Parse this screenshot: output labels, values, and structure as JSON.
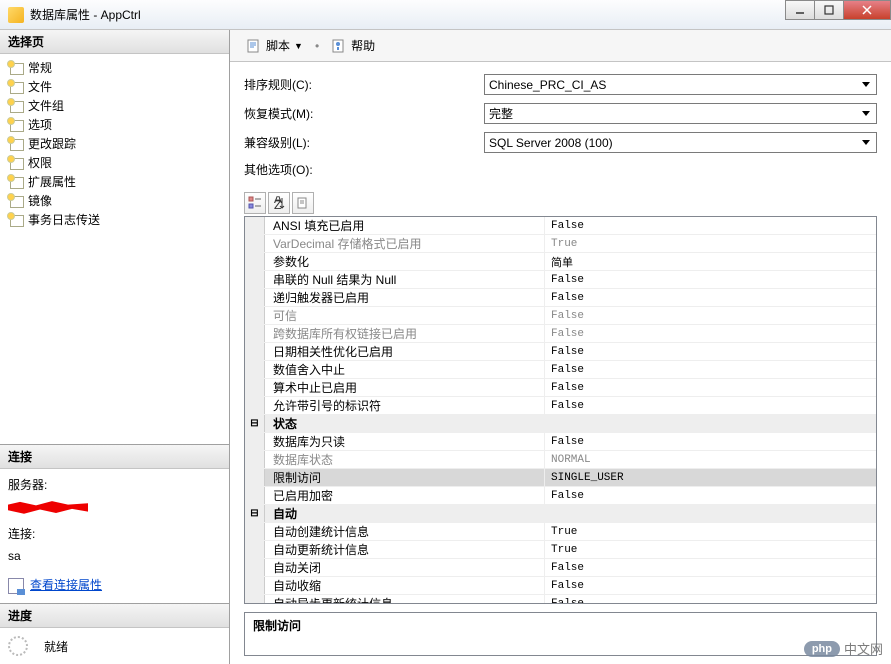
{
  "window": {
    "title": "数据库属性 - AppCtrl"
  },
  "leftPanel": {
    "selectPageHeader": "选择页",
    "navItems": [
      "常规",
      "文件",
      "文件组",
      "选项",
      "更改跟踪",
      "权限",
      "扩展属性",
      "镜像",
      "事务日志传送"
    ],
    "connectionHeader": "连接",
    "serverLabel": "服务器:",
    "connLabel": "连接:",
    "connValue": "sa",
    "viewConnPropsLink": "查看连接属性",
    "progressHeader": "进度",
    "progressStatus": "就绪"
  },
  "toolbar": {
    "script": "脚本",
    "help": "帮助"
  },
  "form": {
    "collationLabel": "排序规则(C):",
    "collationValue": "Chinese_PRC_CI_AS",
    "recoveryLabel": "恢复模式(M):",
    "recoveryValue": "完整",
    "compatLabel": "兼容级别(L):",
    "compatValue": "SQL Server 2008 (100)",
    "otherLabel": "其他选项(O):"
  },
  "grid": {
    "rows": [
      {
        "name": "ANSI 填充已启用",
        "value": "False"
      },
      {
        "name": "VarDecimal 存储格式已启用",
        "value": "True",
        "disabled": true
      },
      {
        "name": "参数化",
        "value": "简单"
      },
      {
        "name": "串联的 Null 结果为 Null",
        "value": "False"
      },
      {
        "name": "递归触发器已启用",
        "value": "False"
      },
      {
        "name": "可信",
        "value": "False",
        "disabled": true
      },
      {
        "name": "跨数据库所有权链接已启用",
        "value": "False",
        "disabled": true
      },
      {
        "name": "日期相关性优化已启用",
        "value": "False"
      },
      {
        "name": "数值舍入中止",
        "value": "False"
      },
      {
        "name": "算术中止已启用",
        "value": "False"
      },
      {
        "name": "允许带引号的标识符",
        "value": "False"
      }
    ],
    "statusCategory": "状态",
    "statusRows": [
      {
        "name": "数据库为只读",
        "value": "False"
      },
      {
        "name": "数据库状态",
        "value": "NORMAL",
        "disabled": true
      },
      {
        "name": "限制访问",
        "value": "SINGLE_USER",
        "selected": true
      },
      {
        "name": "已启用加密",
        "value": "False"
      }
    ],
    "autoCategory": "自动",
    "autoRows": [
      {
        "name": "自动创建统计信息",
        "value": "True"
      },
      {
        "name": "自动更新统计信息",
        "value": "True"
      },
      {
        "name": "自动关闭",
        "value": "False"
      },
      {
        "name": "自动收缩",
        "value": "False"
      },
      {
        "name": "自动异步更新统计信息",
        "value": "False"
      }
    ]
  },
  "descBox": {
    "title": "限制访问"
  },
  "watermark": {
    "badge": "php",
    "text": "中文网"
  }
}
